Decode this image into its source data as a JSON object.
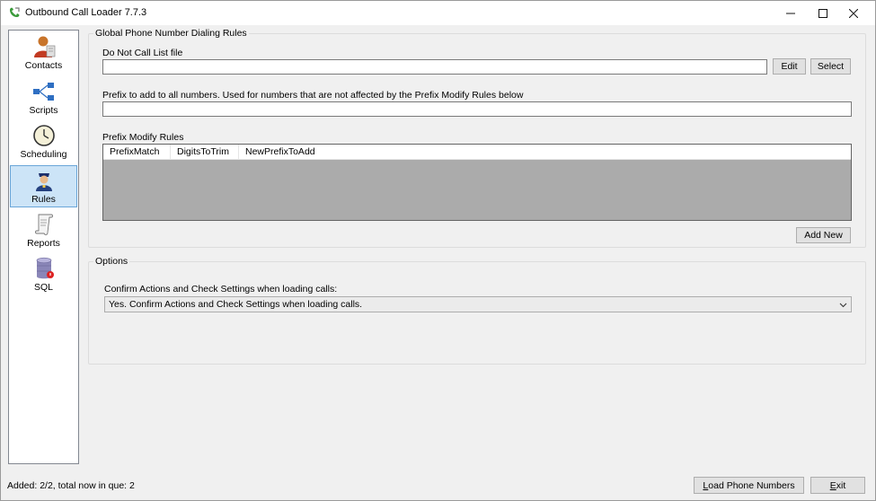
{
  "window": {
    "title": "Outbound Call Loader 7.7.3",
    "controls": {
      "minimize": "—",
      "maximize": "☐",
      "close": "✕"
    }
  },
  "sidebar": {
    "items": [
      {
        "label": "Contacts",
        "icon": "contacts-icon",
        "active": false
      },
      {
        "label": "Scripts",
        "icon": "scripts-icon",
        "active": false
      },
      {
        "label": "Scheduling",
        "icon": "clock-icon",
        "active": false
      },
      {
        "label": "Rules",
        "icon": "rules-icon",
        "active": true
      },
      {
        "label": "Reports",
        "icon": "scroll-icon",
        "active": false
      },
      {
        "label": "SQL",
        "icon": "database-icon",
        "active": false
      }
    ]
  },
  "global_rules": {
    "group_title": "Global Phone Number Dialing Rules",
    "dnc_label": "Do Not Call List file",
    "dnc_value": "",
    "edit_label": "Edit",
    "select_label": "Select",
    "prefix_label": "Prefix to add to all numbers. Used for numbers that are not affected by the Prefix Modify Rules below",
    "prefix_value": "",
    "modify_label": "Prefix Modify Rules",
    "columns": [
      "PrefixMatch",
      "DigitsToTrim",
      "NewPrefixToAdd"
    ],
    "add_new_label": "Add New"
  },
  "options": {
    "group_title": "Options",
    "confirm_label": "Confirm Actions and Check Settings when loading calls:",
    "confirm_selected": "Yes. Confirm Actions and Check Settings when loading calls."
  },
  "footer": {
    "status": "Added: 2/2, total now in que: 2",
    "load_label_mn": "L",
    "load_label_rest": "oad Phone Numbers",
    "exit_label_mn": "E",
    "exit_label_rest": "xit"
  },
  "colors": {
    "accent": "#cce4f7",
    "grid_background": "#ababab",
    "window_background": "#f0f0f0"
  }
}
